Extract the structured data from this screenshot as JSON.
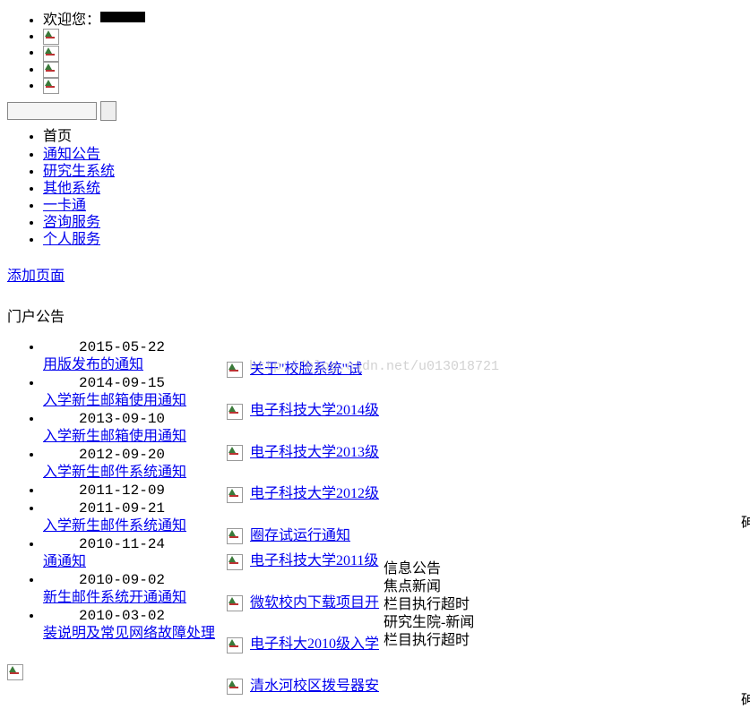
{
  "welcome": {
    "prefix": "欢迎您：",
    "username_redacted": true
  },
  "nav": {
    "items": [
      {
        "label": "首页",
        "link": false
      },
      {
        "label": "通知公告",
        "link": true
      },
      {
        "label": "研究生系统",
        "link": true
      },
      {
        "label": "其他系统",
        "link": true
      },
      {
        "label": "一卡通",
        "link": true
      },
      {
        "label": "咨询服务",
        "link": true
      },
      {
        "label": "个人服务",
        "link": true
      }
    ]
  },
  "add_page": "添加页面",
  "section_title": "门户公告",
  "announcements": [
    {
      "date": "2015-05-22",
      "title": "用版发布的通知"
    },
    {
      "date": "2014-09-15",
      "title": "入学新生邮箱使用通知"
    },
    {
      "date": "2013-09-10",
      "title": "入学新生邮箱使用通知"
    },
    {
      "date": "2012-09-20",
      "title": "入学新生邮件系统通知"
    },
    {
      "date": "2011-12-09",
      "title": ""
    },
    {
      "date": "2011-09-21",
      "title": "入学新生邮件系统通知"
    },
    {
      "date": "2010-11-24",
      "title": "通通知"
    },
    {
      "date": "2010-09-02",
      "title": "新生邮件系统开通通知"
    },
    {
      "date": "2010-03-02",
      "title": "装说明及常见网络故障处理"
    }
  ],
  "right_links": [
    {
      "label": "关于\"校脸系统\"试"
    },
    {
      "label": "电子科技大学2014级"
    },
    {
      "label": "电子科技大学2013级"
    },
    {
      "label": "电子科技大学2012级"
    },
    {
      "label": "圈存试运行通知"
    },
    {
      "label": "电子科技大学2011级"
    },
    {
      "label": "微软校内下载项目开"
    },
    {
      "label": "电子科大2010级入学"
    },
    {
      "label": "清水河校区拨号器安"
    }
  ],
  "info_block": {
    "lines": [
      "信息公告",
      "焦点新闻",
      "栏目执行超时",
      "研究生院-新闻",
      "栏目执行超时"
    ]
  },
  "more_char": "砷",
  "watermark": "http://blog.csdn.net/u013018721"
}
